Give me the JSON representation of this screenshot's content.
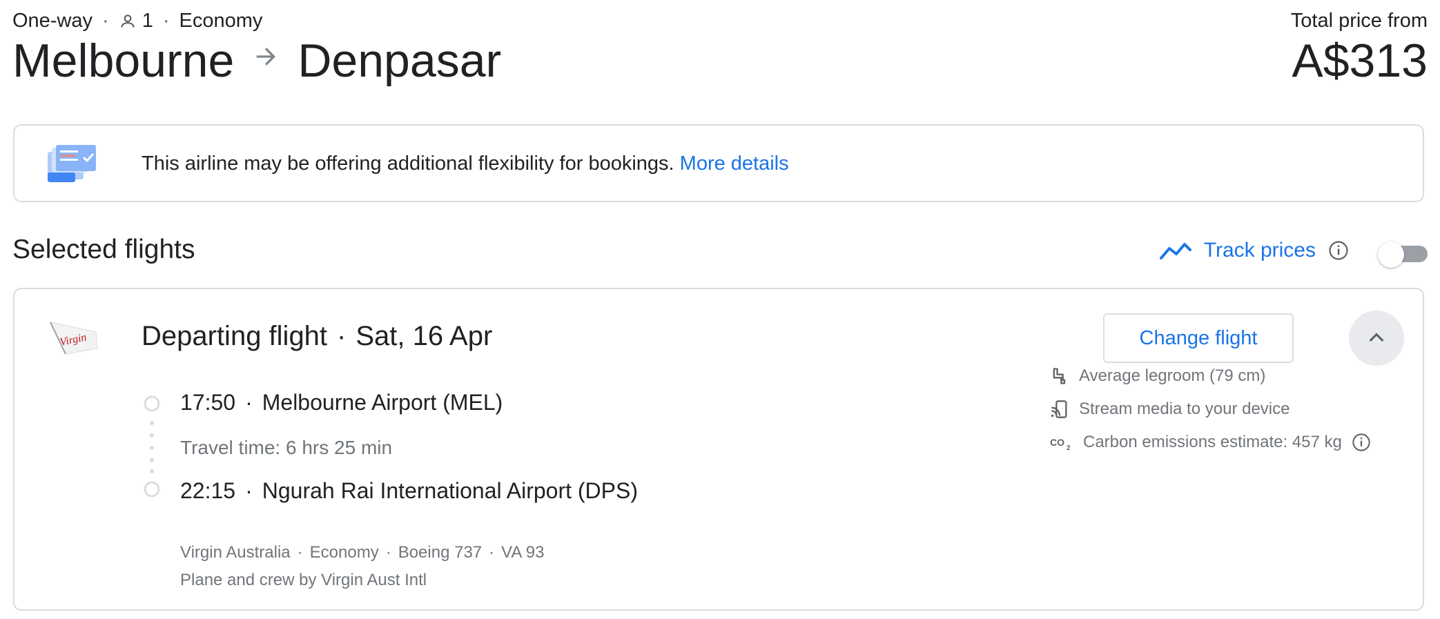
{
  "header": {
    "trip_type": "One-way",
    "passengers": "1",
    "cabin": "Economy",
    "origin": "Melbourne",
    "destination": "Denpasar",
    "price_label": "Total price from",
    "price": "A$313"
  },
  "banner": {
    "text": "This airline may be offering additional flexibility for bookings.",
    "link": "More details",
    "icon": "flexible-booking-icon"
  },
  "section": {
    "title": "Selected flights",
    "track_label": "Track prices",
    "track_enabled": false
  },
  "flight": {
    "title": "Departing flight",
    "date": "Sat, 16 Apr",
    "change_label": "Change flight",
    "departure_time": "17:50",
    "departure_airport": "Melbourne Airport (MEL)",
    "travel_time": "Travel time: 6 hrs 25 min",
    "arrival_time": "22:15",
    "arrival_airport": "Ngurah Rai International Airport (DPS)",
    "airline": "Virgin Australia",
    "cabin": "Economy",
    "aircraft": "Boeing 737",
    "flight_number": "VA 93",
    "operator": "Plane and crew by Virgin Aust Intl",
    "logo_text": "Virgin",
    "amenities": [
      {
        "icon": "legroom-seat-icon",
        "label": "Average legroom (79 cm)"
      },
      {
        "icon": "stream-media-icon",
        "label": "Stream media to your device"
      },
      {
        "icon": "co2-icon",
        "label": "Carbon emissions estimate: 457 kg"
      }
    ]
  },
  "colors": {
    "accent": "#1a73e8",
    "border": "#dadce0",
    "muted_text": "#70757a",
    "primary_text": "#202124"
  }
}
